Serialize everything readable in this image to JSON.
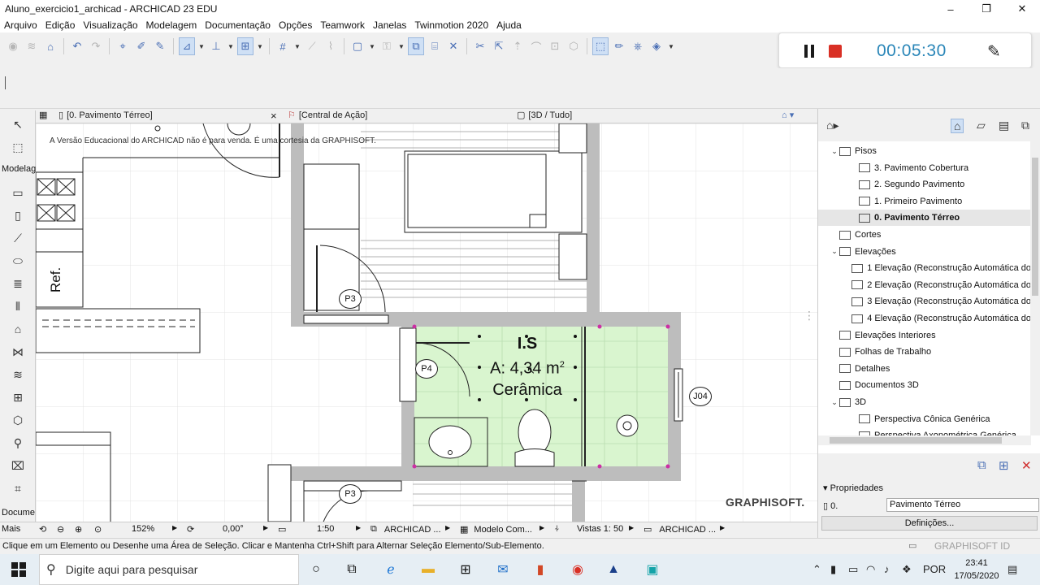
{
  "window": {
    "title": "Aluno_exercicio1_archicad - ARCHICAD 23 EDU",
    "minimize": "–",
    "maximize": "❐",
    "close": "✕"
  },
  "menu": [
    "Arquivo",
    "Edição",
    "Visualização",
    "Modelagem",
    "Documentação",
    "Opções",
    "Teamwork",
    "Janelas",
    "Twinmotion 2020",
    "Ajuda"
  ],
  "recorder": {
    "time": "00:05:30",
    "pen_icon": "✎"
  },
  "toolbox": {
    "group_label": "Modelag",
    "doc_label": "Docume",
    "more_label": "Mais"
  },
  "tabs": {
    "floor_plan": "[0. Pavimento Térreo]",
    "close": "×",
    "action_center": "[Central de Ação]",
    "view_3d": "[3D / Tudo]"
  },
  "canvas": {
    "notice": "A Versão Educacional do ARCHICAD não é para venda. É uma cortesia da GRAPHISOFT.",
    "brand": "GRAPHISOFT.",
    "labels": {
      "ref": "Ref.",
      "p3_top": "P3",
      "p4": "P4",
      "p3_bottom": "P3",
      "j04": "J04"
    },
    "zone": {
      "name": "I.S",
      "area_prefix": "A: 4,34 m",
      "area_exponent": "2",
      "material": "Cerâmica",
      "fill_color": "#d9f5cf",
      "marker_color": "#cc2fa4"
    }
  },
  "navbar": {
    "zoom": "152%",
    "angle": "0,00°",
    "scale": "1:50",
    "layer_combo": "ARCHICAD ...",
    "model_view": "Modelo Com...",
    "dimensions": "Vistas 1: 50",
    "pen_set": "ARCHICAD ..."
  },
  "status": {
    "message": "Clique em um Elemento ou Desenhe uma Área de Seleção. Clicar e Mantenha Ctrl+Shift para Alternar Seleção Elemento/Sub-Elemento.",
    "graphisoft_id": "GRAPHISOFT ID"
  },
  "navigator": {
    "tree": [
      {
        "label": "Pisos",
        "level": 1,
        "toggle": "⌄"
      },
      {
        "label": "3. Pavimento Cobertura",
        "level": 2
      },
      {
        "label": "2. Segundo Pavimento",
        "level": 2
      },
      {
        "label": "1. Primeiro Pavimento",
        "level": 2
      },
      {
        "label": "0. Pavimento Térreo",
        "level": 2,
        "selected": true
      },
      {
        "label": "Cortes",
        "level": 1
      },
      {
        "label": "Elevações",
        "level": 1,
        "toggle": "⌄"
      },
      {
        "label": "1 Elevação (Reconstrução Automática do",
        "level": 2
      },
      {
        "label": "2 Elevação (Reconstrução Automática do",
        "level": 2
      },
      {
        "label": "3 Elevação (Reconstrução Automática do",
        "level": 2
      },
      {
        "label": "4 Elevação (Reconstrução Automática do",
        "level": 2
      },
      {
        "label": "Elevações Interiores",
        "level": 1
      },
      {
        "label": "Folhas de Trabalho",
        "level": 1
      },
      {
        "label": "Detalhes",
        "level": 1
      },
      {
        "label": "Documentos 3D",
        "level": 1
      },
      {
        "label": "3D",
        "level": 1,
        "toggle": "⌄"
      },
      {
        "label": "Perspectiva Cônica Genérica",
        "level": 2
      },
      {
        "label": "Perspectiva Axonométrica Genérica",
        "level": 2
      }
    ]
  },
  "properties": {
    "header": "Propriedades",
    "level_number": "0.",
    "level_name": "Pavimento Térreo",
    "settings_button": "Definições..."
  },
  "taskbar": {
    "search_placeholder": "Digite aqui para pesquisar",
    "language": "POR",
    "time": "23:41",
    "date": "17/05/2020"
  }
}
